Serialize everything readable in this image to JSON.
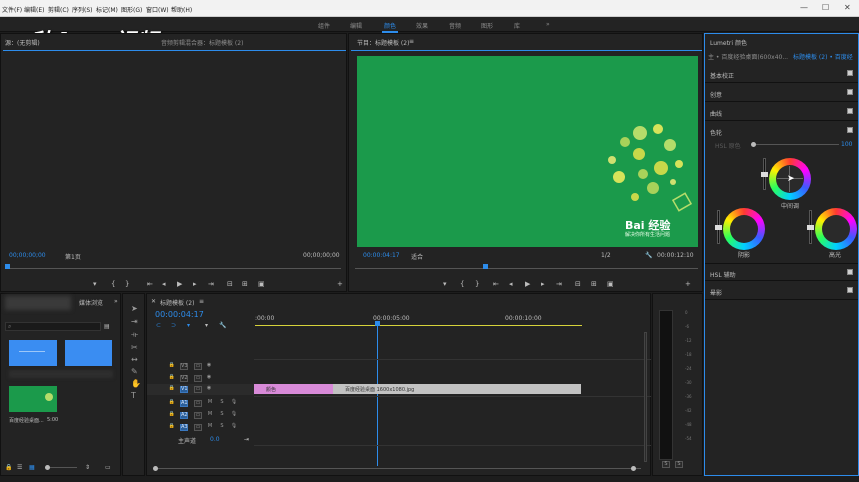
{
  "menu": {
    "items": [
      "文件(F)",
      "编辑(E)",
      "剪辑(C)",
      "序列(S)",
      "标记(M)",
      "图形(G)",
      "窗口(W)",
      "帮助(H)"
    ]
  },
  "workspaces": {
    "items": [
      "组件",
      "编辑",
      "颜色",
      "效果",
      "音频",
      "图形",
      "库"
    ],
    "active": "颜色",
    "more": "»"
  },
  "watermark": {
    "text": "秒dong视频"
  },
  "source": {
    "title": "源：(无剪辑)",
    "tabs": [
      "音频剪辑混合器：标题模板 (2)"
    ],
    "timecode_left": "00;00;00;00",
    "page": "第1页",
    "timecode_right": "00;00;00;00"
  },
  "program": {
    "title": "节目：标题模板 (2)",
    "timecode_left": "00:00:04:17",
    "fit": "适合",
    "resolution": "1/2",
    "timecode_right": "00:00:12:10",
    "overlay_logo": "Bai 经验",
    "overlay_sub": "解决你所有生活问题"
  },
  "lumetri": {
    "title": "Lumetri 颜色",
    "clip_label": "主 • 百度经验桌面(600x40...",
    "seq_label": "标题模板 (2) • 百度经",
    "sections": [
      "基本校正",
      "创意",
      "曲线",
      "色轮",
      "HSL 辅助",
      "晕影"
    ],
    "slider_label": "HSL 原色",
    "slider_value": "100",
    "wheels": {
      "midtones": "中间调",
      "shadows": "阴影",
      "highlights": "高光"
    }
  },
  "project": {
    "title": "项目：未命名",
    "tab2": "媒体浏览",
    "thumb_label": "百度经验桌面...",
    "thumb_dur": "5:00"
  },
  "timeline": {
    "title": "标题模板 (2)",
    "timecode": "00:00:04:17",
    "ruler": [
      ":00:00",
      "00:00:05:00",
      "00:00:10:00"
    ],
    "video_tracks": [
      "V3",
      "V2",
      "V1"
    ],
    "audio_tracks": [
      "A1",
      "A2",
      "A3"
    ],
    "master_label": "主声道",
    "master_value": "0.0",
    "clips": {
      "pink": "颜色",
      "gray": "百度经验桌面 1600x1080.jpg"
    }
  },
  "meter": {
    "scale": [
      "0",
      "-6",
      "-12",
      "-18",
      "-24",
      "-30",
      "-36",
      "-42",
      "-48",
      "-54"
    ],
    "solo": [
      "S",
      "S"
    ]
  },
  "colors": {
    "accent": "#2d8ceb",
    "video_green": "#1b9a4b",
    "clip_pink": "#d88ad8",
    "clip_gray": "#c2c2c2",
    "thumb_blue": "#3a8df2"
  }
}
